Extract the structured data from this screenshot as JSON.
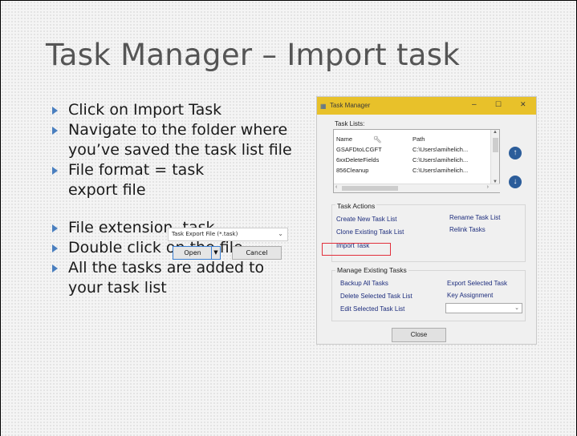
{
  "slide": {
    "title": "Task Manager – Import task",
    "bullets_top": [
      "Click on Import Task",
      "Navigate to the folder where you’ve saved the task list file",
      "File format = task export file"
    ],
    "bullets_bottom": [
      "File extension .task",
      "Double click on the file",
      "All the tasks are added to your task list"
    ],
    "bullet_color": "#4a7fbf"
  },
  "file_dialog_snippet": {
    "filter_value": "Task Export File (*.task)",
    "open_label": "Open",
    "cancel_label": "Cancel"
  },
  "task_manager": {
    "title": "Task Manager",
    "titlebar_color": "#e8c12a",
    "window_buttons": {
      "minimize": "–",
      "maximize": "☐",
      "close": "✕"
    },
    "task_lists_label": "Task Lists:",
    "columns": [
      "Name",
      "Path"
    ],
    "rows": [
      {
        "name": "GSAFDtoLCGFT",
        "path": "C:\\Users\\amihelich..."
      },
      {
        "name": "6xxDeleteFields",
        "path": "C:\\Users\\amihelich..."
      },
      {
        "name": "856Cleanup",
        "path": "C:\\Users\\amihelich..."
      }
    ],
    "move_up_icon": "arrow-up-icon",
    "move_down_icon": "arrow-down-icon",
    "task_actions": {
      "label": "Task Actions",
      "create": "Create New Task List",
      "rename": "Rename Task List",
      "clone": "Clone Existing Task List",
      "relink": "Relink Tasks",
      "import": "Import Task"
    },
    "manage": {
      "label": "Manage Existing Tasks",
      "backup": "Backup All Tasks",
      "export": "Export Selected Task",
      "delete": "Delete Selected Task List",
      "key": "Key Assignment",
      "edit": "Edit Selected Task List",
      "key_combo_value": ""
    },
    "close_label": "Close",
    "highlight_color": "#e2303c"
  }
}
